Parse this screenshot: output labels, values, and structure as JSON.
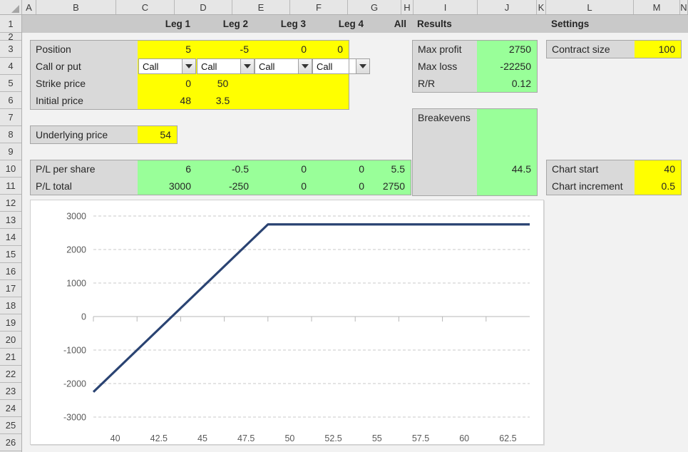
{
  "spreadsheet": {
    "columns": [
      "A",
      "B",
      "C",
      "D",
      "E",
      "F",
      "G",
      "H",
      "I",
      "J",
      "K",
      "L",
      "M",
      "N"
    ],
    "rows": [
      "1",
      "2",
      "3",
      "4",
      "5",
      "6",
      "7",
      "8",
      "9",
      "10",
      "11",
      "12",
      "13",
      "14",
      "15",
      "16",
      "17",
      "18",
      "19",
      "20",
      "21",
      "22",
      "23",
      "24",
      "25",
      "26"
    ],
    "select_all_icon": "select-all-triangle"
  },
  "banners": {
    "leg1": "Leg 1",
    "leg2": "Leg 2",
    "leg3": "Leg 3",
    "leg4": "Leg 4",
    "all": "All",
    "results": "Results",
    "settings": "Settings"
  },
  "legs_panel": {
    "rows": [
      {
        "label": "Position",
        "values": [
          "5",
          "-5",
          "0",
          "0"
        ],
        "style": "yellow"
      },
      {
        "label": "Call or put",
        "values": [
          "Call",
          "Call",
          "Call",
          "Call"
        ],
        "style": "dropdown"
      },
      {
        "label": "Strike price",
        "values": [
          "0",
          "50",
          "",
          ""
        ],
        "style": "yellow"
      },
      {
        "label": "Initial price",
        "values": [
          "48",
          "3.5",
          "",
          ""
        ],
        "style": "yellow"
      }
    ],
    "dropdown_icon": "chevron-down-icon"
  },
  "underlying": {
    "label": "Underlying price",
    "value": "54"
  },
  "pl_panel": {
    "rows": [
      {
        "label": "P/L per share",
        "values": [
          "6",
          "-0.5",
          "0",
          "0",
          "5.5"
        ]
      },
      {
        "label": "P/L total",
        "values": [
          "3000",
          "-250",
          "0",
          "0",
          "2750"
        ]
      }
    ]
  },
  "results_panel": {
    "rows": [
      {
        "label": "Max profit",
        "value": "2750"
      },
      {
        "label": "Max loss",
        "value": "-22250"
      },
      {
        "label": "R/R",
        "value": "0.12"
      }
    ]
  },
  "breakevens_panel": {
    "label": "Breakevens",
    "values": [
      "",
      "",
      "44.5"
    ]
  },
  "settings_panel": {
    "contract_size": {
      "label": "Contract size",
      "value": "100"
    },
    "chart_start": {
      "label": "Chart start",
      "value": "40"
    },
    "chart_increment": {
      "label": "Chart increment",
      "value": "0.5"
    }
  },
  "colors": {
    "input_yellow": "#ffff00",
    "output_green": "#99ff99",
    "label_gray": "#d9d9d9",
    "banner_gray": "#c9c9c9",
    "line_navy": "#2a4372"
  },
  "chart_data": {
    "type": "line",
    "title": "",
    "xlabel": "",
    "ylabel": "",
    "xlim": [
      40,
      65
    ],
    "ylim": [
      -3000,
      3000
    ],
    "grid": true,
    "legend": false,
    "xticks": [
      40,
      42.5,
      45,
      47.5,
      50,
      52.5,
      55,
      57.5,
      60,
      62.5
    ],
    "xtick_labels": [
      "40",
      "42.5",
      "45",
      "47.5",
      "50",
      "52.5",
      "55",
      "57.5",
      "60",
      "62.5"
    ],
    "yticks": [
      -3000,
      -2000,
      -1000,
      0,
      1000,
      2000,
      3000
    ],
    "ytick_labels": [
      "-3000",
      "-2000",
      "-1000",
      "0",
      "1000",
      "2000",
      "3000"
    ],
    "series": [
      {
        "name": "P/L total",
        "color": "#2a4372",
        "x": [
          40,
          41,
          42,
          43,
          44,
          44.5,
          45,
          46,
          47,
          48,
          49,
          50,
          51,
          52,
          53,
          54,
          55,
          56,
          57,
          58,
          59,
          60,
          61,
          62,
          63,
          64,
          65
        ],
        "y": [
          -2250,
          -1750,
          -1250,
          -750,
          -250,
          0,
          250,
          750,
          1250,
          1750,
          2250,
          2750,
          2750,
          2750,
          2750,
          2750,
          2750,
          2750,
          2750,
          2750,
          2750,
          2750,
          2750,
          2750,
          2750,
          2750,
          2750
        ]
      }
    ]
  }
}
